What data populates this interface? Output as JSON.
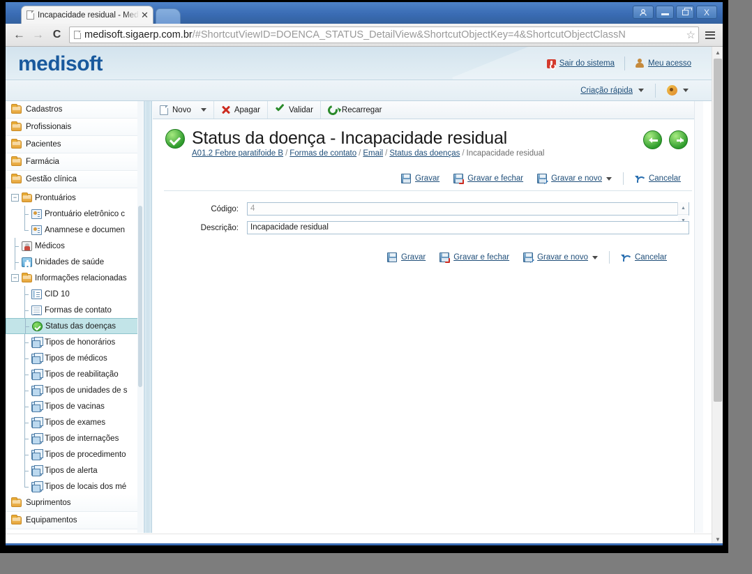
{
  "browser": {
    "tab_title": "Incapacidade residual - Medi",
    "tab_close": "✕",
    "back_icon": "←",
    "forward_icon": "→",
    "reload_icon": "C",
    "url_highlight": "medisoft.sigaerp.com.br",
    "url_rest": "/#ShortcutViewID=DOENCA_STATUS_DetailView&ShortcutObjectKey=4&ShortcutObjectClassN",
    "star_icon": "☆",
    "window_user": "☺",
    "window_close": "X"
  },
  "app_header": {
    "logo": "medisoft",
    "logout_label": "Sair do sistema",
    "account_label": "Meu acesso",
    "quick_create_label": "Criação rápida"
  },
  "sidebar": {
    "roots": [
      {
        "label": "Cadastros"
      },
      {
        "label": "Profissionais"
      },
      {
        "label": "Pacientes"
      },
      {
        "label": "Farmácia"
      },
      {
        "label": "Gestão clínica"
      }
    ],
    "tree": [
      {
        "label": "Prontuários",
        "icon": "folder",
        "depth": 1,
        "expander": "−"
      },
      {
        "label": "Prontuário eletrônico c",
        "icon": "card",
        "depth": 2
      },
      {
        "label": "Anamnese e documen",
        "icon": "card",
        "depth": 2,
        "last": true
      },
      {
        "label": "Médicos",
        "icon": "md",
        "depth": 1
      },
      {
        "label": "Unidades de saúde",
        "icon": "hosp",
        "depth": 1
      },
      {
        "label": "Informações relacionadas",
        "icon": "folder",
        "depth": 1,
        "expander": "−"
      },
      {
        "label": "CID 10",
        "icon": "cid",
        "depth": 2
      },
      {
        "label": "Formas de contato",
        "icon": "doc",
        "depth": 2
      },
      {
        "label": "Status das doenças",
        "icon": "check",
        "depth": 2,
        "selected": true
      },
      {
        "label": "Tipos de honorários",
        "icon": "cube",
        "depth": 2
      },
      {
        "label": "Tipos de médicos",
        "icon": "cube",
        "depth": 2
      },
      {
        "label": "Tipos de reabilitação",
        "icon": "cube",
        "depth": 2
      },
      {
        "label": "Tipos de unidades de s",
        "icon": "cube",
        "depth": 2
      },
      {
        "label": "Tipos de vacinas",
        "icon": "cube",
        "depth": 2
      },
      {
        "label": "Tipos de exames",
        "icon": "cube",
        "depth": 2
      },
      {
        "label": "Tipos de internações",
        "icon": "cube",
        "depth": 2
      },
      {
        "label": "Tipos de procedimento",
        "icon": "cube",
        "depth": 2
      },
      {
        "label": "Tipos de alerta",
        "icon": "cube",
        "depth": 2
      },
      {
        "label": "Tipos de locais dos mé",
        "icon": "cube",
        "depth": 2,
        "last": true
      }
    ],
    "roots_bottom": [
      {
        "label": "Suprimentos"
      },
      {
        "label": "Equipamentos"
      }
    ]
  },
  "toolbar": {
    "new_label": "Novo",
    "delete_label": "Apagar",
    "validate_label": "Validar",
    "reload_label": "Recarregar"
  },
  "detail": {
    "title": "Status da doença - Incapacidade residual",
    "breadcrumb": [
      {
        "label": "A01.2 Febre paratifoide B",
        "link": true
      },
      {
        "label": "Formas de contato",
        "link": true
      },
      {
        "label": "Email",
        "link": true
      },
      {
        "label": "Status das doenças",
        "link": true
      },
      {
        "label": "Incapacidade residual",
        "link": false
      }
    ],
    "breadcrumb_sep": "/",
    "actions": {
      "save": "Gravar",
      "save_close": "Gravar e fechar",
      "save_new": "Gravar e novo",
      "cancel": "Cancelar"
    },
    "fields": [
      {
        "label": "Código:",
        "value": "4",
        "readonly": true,
        "spinner": true
      },
      {
        "label": "Descrição:",
        "value": "Incapacidade residual",
        "readonly": false,
        "spinner": false
      }
    ]
  },
  "colors": {
    "brand_blue": "#19599d",
    "link_blue": "#1f4e79",
    "selection_teal": "#c2e4e8",
    "status_green": "#2f9b2d",
    "danger_red": "#cc2b20"
  }
}
